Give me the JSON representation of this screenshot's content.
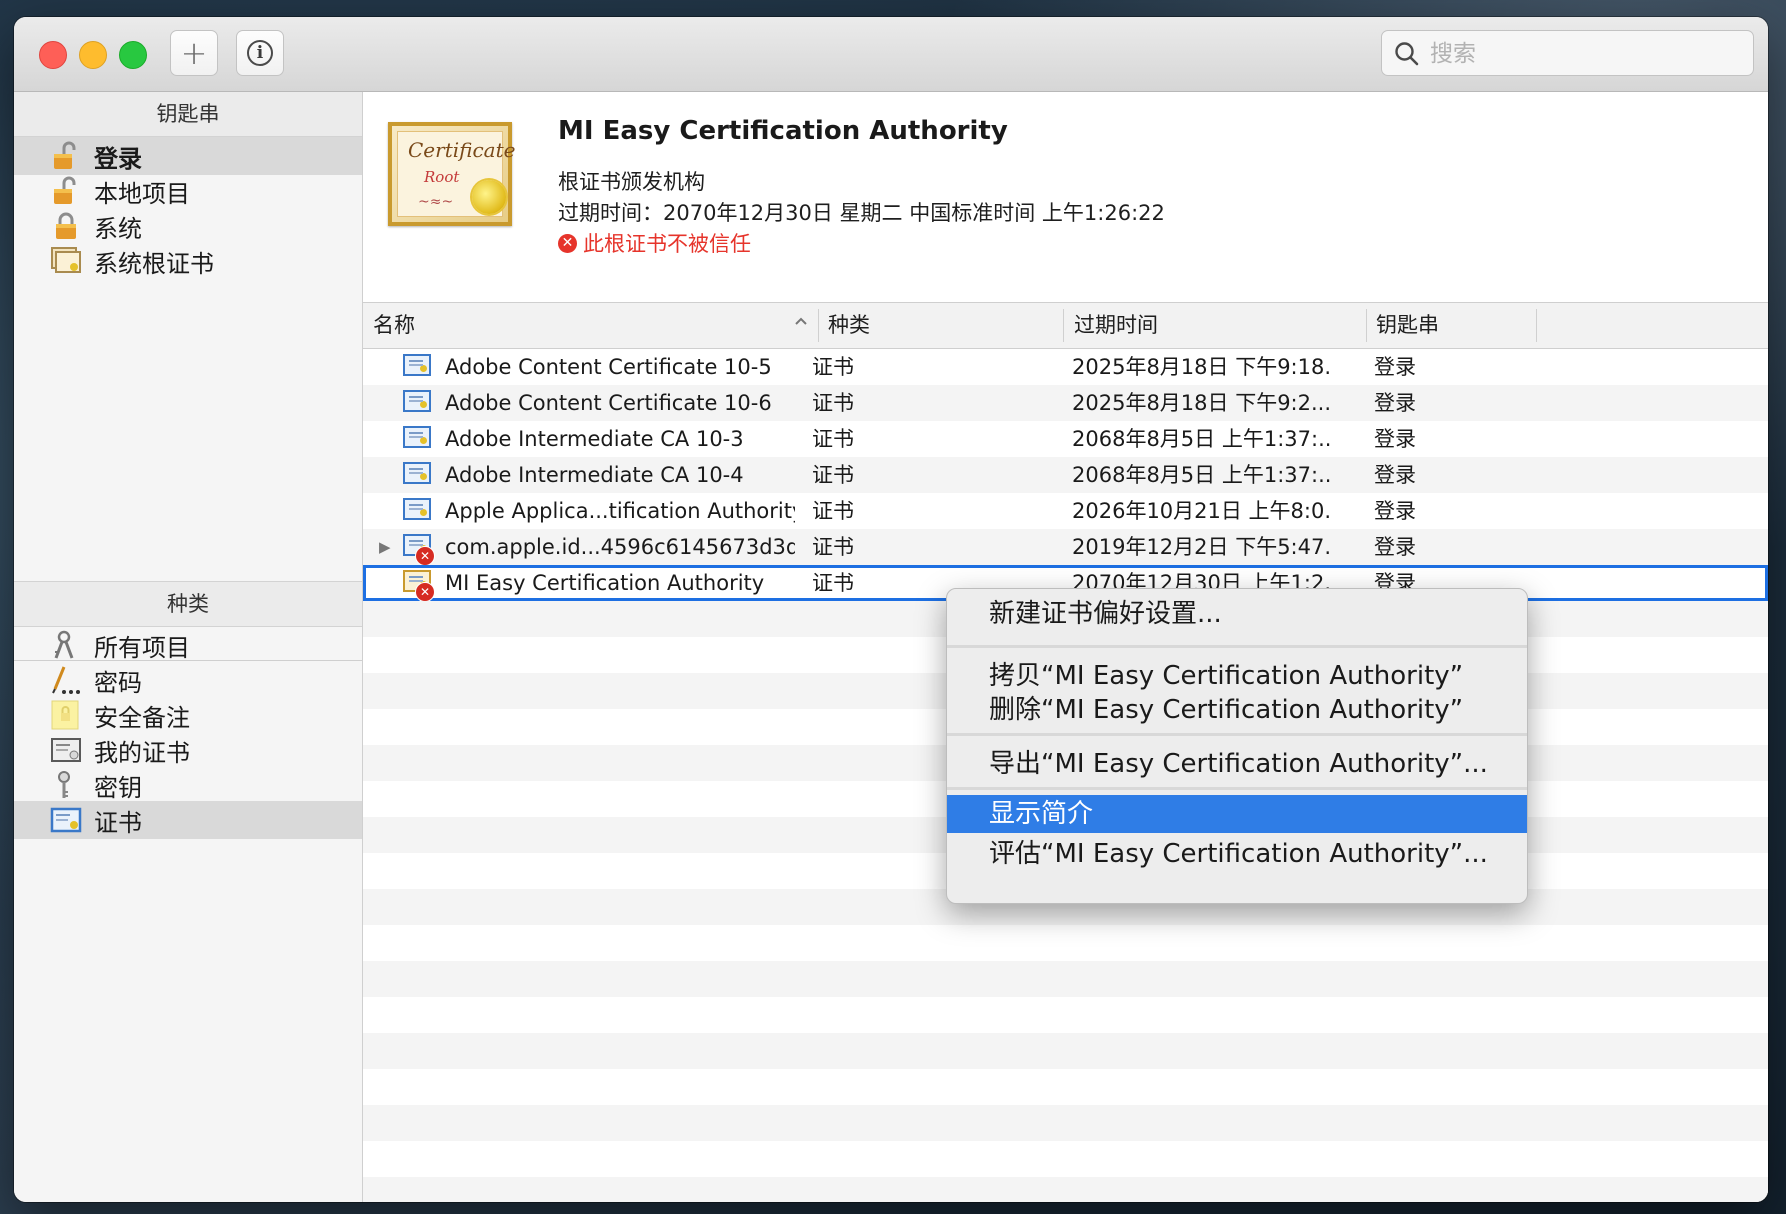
{
  "toolbar": {
    "search_placeholder": "搜索"
  },
  "sidebar": {
    "keychains_header": "钥匙串",
    "keychains": [
      {
        "label": "登录",
        "icon": "lock-open-icon"
      },
      {
        "label": "本地项目",
        "icon": "lock-open-icon"
      },
      {
        "label": "系统",
        "icon": "lock-icon"
      },
      {
        "label": "系统根证书",
        "icon": "certificate-icon"
      }
    ],
    "category_header": "种类",
    "categories": [
      {
        "label": "所有项目",
        "icon": "all-items-icon"
      },
      {
        "label": "密码",
        "icon": "password-icon"
      },
      {
        "label": "安全备注",
        "icon": "secure-note-icon"
      },
      {
        "label": "我的证书",
        "icon": "my-certificate-icon"
      },
      {
        "label": "密钥",
        "icon": "key-icon"
      },
      {
        "label": "证书",
        "icon": "certificate-icon"
      }
    ]
  },
  "detail": {
    "cert_word": "Certificate",
    "cert_root": "Root",
    "title": "MI Easy Certification Authority",
    "subtitle": "根证书颁发机构",
    "expires": "过期时间：2070年12月30日 星期二 中国标准时间 上午1:26:22",
    "warning": "此根证书不被信任"
  },
  "table": {
    "headers": {
      "name": "名称",
      "kind": "种类",
      "expires": "过期时间",
      "keychain": "钥匙串"
    },
    "rows": [
      {
        "name": "Adobe Content Certificate 10-5",
        "kind": "证书",
        "expires": "2025年8月18日 下午9:18...",
        "keychain": "登录"
      },
      {
        "name": "Adobe Content Certificate 10-6",
        "kind": "证书",
        "expires": "2025年8月18日 下午9:2...",
        "keychain": "登录"
      },
      {
        "name": "Adobe Intermediate CA 10-3",
        "kind": "证书",
        "expires": "2068年8月5日 上午1:37:...",
        "keychain": "登录"
      },
      {
        "name": "Adobe Intermediate CA 10-4",
        "kind": "证书",
        "expires": "2068年8月5日 上午1:37:...",
        "keychain": "登录"
      },
      {
        "name": "Apple Applica...tification Authority",
        "kind": "证书",
        "expires": "2026年10月21日 上午8:0...",
        "keychain": "登录"
      },
      {
        "name": "com.apple.id...4596c6145673d3d",
        "kind": "证书",
        "expires": "2019年12月2日 下午5:47...",
        "keychain": "登录"
      },
      {
        "name": "MI Easy Certification Authority",
        "kind": "证书",
        "expires": "2070年12月30日 上午1:2...",
        "keychain": "登录"
      }
    ]
  },
  "context_menu": {
    "items": [
      "新建证书偏好设置...",
      "拷贝“MI Easy Certification Authority”",
      "删除“MI Easy Certification Authority”",
      "导出“MI Easy Certification Authority”...",
      "显示简介",
      "评估“MI Easy Certification Authority”..."
    ]
  },
  "colors": {
    "selection": "#2f7de6",
    "warning": "#e6342b",
    "row_outline": "#1d6fe2"
  }
}
